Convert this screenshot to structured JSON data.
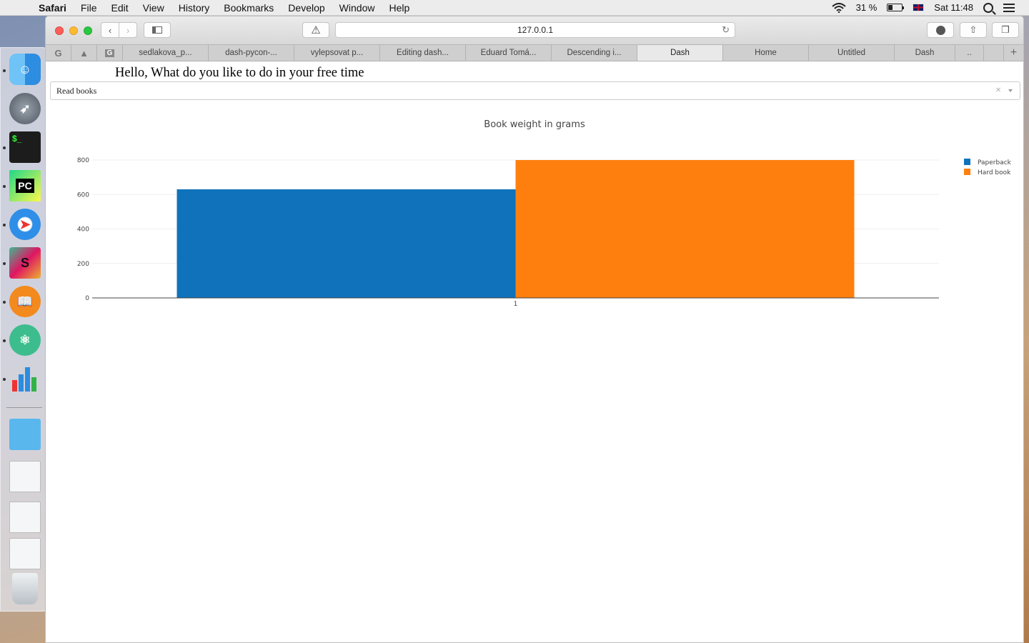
{
  "menubar": {
    "app": "Safari",
    "items": [
      "File",
      "Edit",
      "View",
      "History",
      "Bookmarks",
      "Develop",
      "Window",
      "Help"
    ],
    "battery": "31 %",
    "battery_level": 0.31,
    "clock": "Sat 11:48"
  },
  "browser": {
    "url": "127.0.0.1",
    "tabs": [
      {
        "label": "sedlakova_p..."
      },
      {
        "label": "dash-pycon-..."
      },
      {
        "label": "vylepsovat p..."
      },
      {
        "label": "Editing dash..."
      },
      {
        "label": "Eduard Tomá..."
      },
      {
        "label": "Descending i..."
      },
      {
        "label": "Dash",
        "active": true
      },
      {
        "label": "Home"
      },
      {
        "label": "Untitled"
      },
      {
        "label": "Dash"
      },
      {
        "label": ".."
      }
    ]
  },
  "page": {
    "greeting": "Hello, What do you like to do in your free time",
    "dropdown_value": "Read books",
    "clear_glyph": "×"
  },
  "chart_data": {
    "type": "bar",
    "title": "Book weight in grams",
    "xlabel": "",
    "ylabel": "",
    "categories": [
      "1"
    ],
    "series": [
      {
        "name": "Paperback",
        "values": [
          630
        ],
        "color": "#0f72bb"
      },
      {
        "name": "Hard book",
        "values": [
          800
        ],
        "color": "#ff7f0e"
      }
    ],
    "ylim": [
      0,
      800
    ],
    "yticks": [
      0,
      200,
      400,
      600,
      800
    ],
    "grid": true,
    "legend": "top-right"
  },
  "dock": {
    "icons": [
      "finder-icon",
      "launchpad-icon",
      "terminal-icon",
      "pycharm-icon",
      "safari-icon",
      "slack-icon",
      "ibooks-icon",
      "atom-icon",
      "numbers-icon",
      "downloads-folder-icon",
      "numbers-window-icon",
      "pycharm-window-icon",
      "ibooks-window-icon",
      "trash-icon"
    ]
  }
}
